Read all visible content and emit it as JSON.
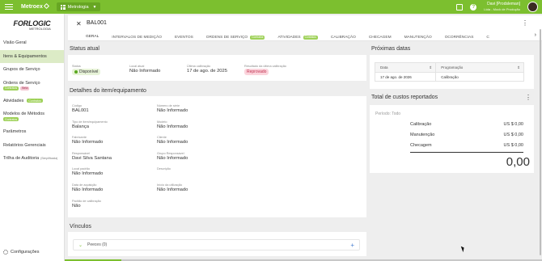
{
  "topbar": {
    "brand": "Metroex",
    "module": "Metrologia",
    "user_name": "Davi [Prodsleman]",
    "user_company": "Ltda - Mock de Produção"
  },
  "sidebar": {
    "logo_title": "FORLOGIC",
    "logo_subtitle": "METROLOGIA",
    "items": [
      {
        "label": "Visão Geral"
      },
      {
        "label": "Itens & Equipamentos"
      },
      {
        "label": "Grupos de Serviço"
      },
      {
        "label": "Ordens de Serviço",
        "badges": [
          "Contratos",
          "Beta"
        ]
      },
      {
        "label": "Atividades",
        "badge": "Contratos"
      },
      {
        "label": "Modelos de Métodos",
        "badge": "Contratos"
      },
      {
        "label": "Parâmetros"
      },
      {
        "label": "Relatórios Gerenciais"
      },
      {
        "label": "Trilha de Auditoria",
        "note": "(Simplificada)"
      }
    ],
    "config_label": "Configurações"
  },
  "header": {
    "title": "BAL001",
    "tabs": [
      {
        "label": "GERAL"
      },
      {
        "label": "INTERVALOS DE MEDIÇÃO"
      },
      {
        "label": "EVENTOS"
      },
      {
        "label": "ORDENS DE SERVIÇO",
        "badge": "Contratos"
      },
      {
        "label": "ATIVIDADES",
        "badge": "Contratos"
      },
      {
        "label": "CALIBRAÇÃO"
      },
      {
        "label": "CHECAGEM"
      },
      {
        "label": "MANUTENÇÃO"
      },
      {
        "label": "OCORRÊNCIAS"
      },
      {
        "label": "C"
      }
    ]
  },
  "status": {
    "title": "Status atual",
    "status_label": "Status",
    "status_value": "Disponível",
    "location_label": "Local atual",
    "location_value": "Não Informado",
    "last_cal_label": "Última calibração",
    "last_cal_value": "17 de ago. de 2025",
    "result_label": "Resultado da última calibração",
    "result_value": "Reprovado"
  },
  "details": {
    "title": "Detalhes do item/equipamento",
    "left": [
      {
        "label": "Código",
        "value": "BAL001"
      },
      {
        "label": "Tipo de item/equipamento",
        "value": "Balança"
      },
      {
        "label": "Fabricante",
        "value": "Não Informado"
      },
      {
        "label": "Responsável",
        "value": "Davi Silva Santana"
      },
      {
        "label": "Local padrão",
        "value": "Não Informado"
      },
      {
        "label": "Data de aquisição",
        "value": "Não Informado"
      },
      {
        "label": "Padrão de calibração",
        "value": "Não"
      }
    ],
    "right": [
      {
        "label": "Número de série",
        "value": "Não Informado"
      },
      {
        "label": "Modelo",
        "value": "Não Informado"
      },
      {
        "label": "Cliente",
        "value": "Não Informado"
      },
      {
        "label": "Grupo Responsável",
        "value": "Não Informado"
      },
      {
        "label": "Descrição",
        "value": ""
      },
      {
        "label": "Início da utilização",
        "value": "Não Informado"
      }
    ]
  },
  "next_dates": {
    "title": "Próximas datas",
    "col_date": "Data",
    "col_program": "Programação",
    "rows": [
      {
        "date": "17 de ago. de 2026",
        "program": "Calibração"
      }
    ]
  },
  "costs": {
    "title": "Total de custos reportados",
    "period_label": "Período:",
    "period_value": "Todo",
    "rows": [
      {
        "label": "Calibração",
        "value": "US $ 0,00"
      },
      {
        "label": "Manutenção",
        "value": "US $ 0,00"
      },
      {
        "label": "Checagem",
        "value": "US $ 0,00"
      }
    ],
    "total": "0,00"
  },
  "links": {
    "title": "Vínculos",
    "row_label": "Peeces (0)"
  }
}
